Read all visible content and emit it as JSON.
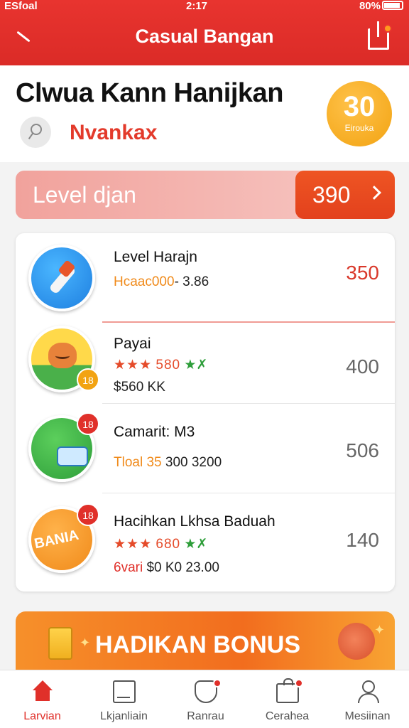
{
  "status": {
    "carrier": "ESfoal",
    "time": "2:17",
    "battery": "80%"
  },
  "header": {
    "title": "Casual Bangan"
  },
  "profile": {
    "name": "Clwua Kann Hanijkan",
    "subtitle": "Nvankax",
    "badge_value": "30",
    "badge_label": "Eirouka"
  },
  "level": {
    "label": "Level djan",
    "value": "390"
  },
  "rows": [
    {
      "title": "Level Harajn",
      "meta1_a": "Hcaac000",
      "meta1_b": "- 3.86",
      "score": "350",
      "score_color": "#d9382a"
    },
    {
      "title": "Payai",
      "stars": "★★★",
      "stars_value": "580",
      "stars_extra": "★✗",
      "meta2": "$560 KK",
      "badge": "18",
      "score": "400",
      "score_color": "#666666"
    },
    {
      "title": "Camarit: M3",
      "meta1_a": "Tloal 35",
      "meta1_b": "300 3200",
      "badge": "18",
      "score": "506",
      "score_color": "#666666"
    },
    {
      "title": "Hacihkan Lkhsa Baduah",
      "icon_word": "BANIA",
      "stars": "★★★",
      "stars_value": "680",
      "stars_extra": "★✗",
      "meta2_a": "6vari",
      "meta2_b": "$0 K0 23.00",
      "badge": "18",
      "score": "140",
      "score_color": "#666666"
    }
  ],
  "bonus": {
    "label": "HADIKAN BONUS"
  },
  "nav": [
    {
      "label": "Larvian",
      "icon": "home-icon",
      "active": true
    },
    {
      "label": "Lkjanliain",
      "icon": "document-icon",
      "active": false
    },
    {
      "label": "Ranrau",
      "icon": "shield-icon",
      "active": false
    },
    {
      "label": "Cerahea",
      "icon": "bag-icon",
      "active": false
    },
    {
      "label": "Mesiinan",
      "icon": "user-icon",
      "active": false
    }
  ],
  "colors": {
    "primary": "#e0302a",
    "accent": "#f08a1a",
    "gold": "#f2a312"
  }
}
